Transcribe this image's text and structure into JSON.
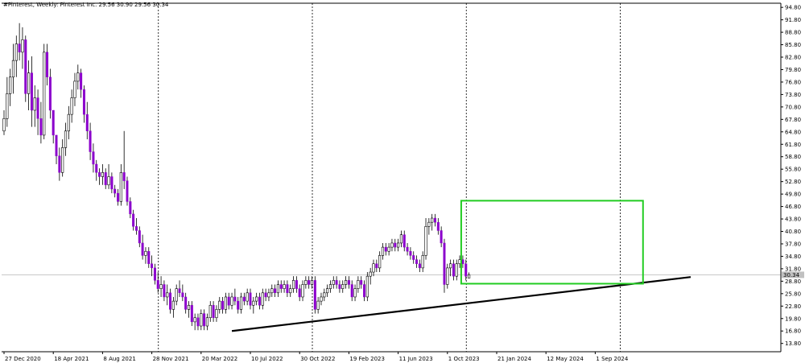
{
  "header": {
    "title": "#Pinterest, Weekly:  Pinterest Inc.  29.56 30.90 29.56 30.34"
  },
  "colors": {
    "background": "#ffffff",
    "bull_body": "#ffffff",
    "bull_edge": "#000000",
    "bear_body": "#8b00cc",
    "wick": "#000000",
    "grid": "#000000",
    "trendline": "#000000",
    "box": "#22cc22",
    "price_line": "#c0c0c0",
    "price_tag_bg": "#c0c0c0"
  },
  "chart_data": {
    "type": "candlestick",
    "title": "#Pinterest, Weekly:  Pinterest Inc.  29.56 30.90 29.56 30.34",
    "ylim": [
      11.8,
      95.8
    ],
    "y_ticks": [
      "94.80",
      "91.80",
      "88.80",
      "85.80",
      "82.80",
      "79.80",
      "76.80",
      "73.80",
      "70.80",
      "67.80",
      "64.80",
      "61.80",
      "58.80",
      "55.80",
      "52.80",
      "49.80",
      "46.80",
      "43.80",
      "40.80",
      "37.80",
      "34.80",
      "31.80",
      "28.80",
      "25.80",
      "22.80",
      "19.80",
      "16.80",
      "13.80"
    ],
    "x_ticks": [
      {
        "label": "27 Dec 2020",
        "bar": 0
      },
      {
        "label": "18 Apr 2021",
        "bar": 16
      },
      {
        "label": "8 Aug 2021",
        "bar": 32
      },
      {
        "label": "28 Nov 2021",
        "bar": 48
      },
      {
        "label": "20 Mar 2022",
        "bar": 64
      },
      {
        "label": "10 Jul 2022",
        "bar": 80
      },
      {
        "label": "30 Oct 2022",
        "bar": 96
      },
      {
        "label": "19 Feb 2023",
        "bar": 112
      },
      {
        "label": "11 Jun 2023",
        "bar": 128
      },
      {
        "label": "1 Oct 2023",
        "bar": 144
      },
      {
        "label": "21 Jan 2024",
        "bar": 160
      },
      {
        "label": "12 May 2024",
        "bar": 176
      },
      {
        "label": "1 Sep 2024",
        "bar": 192
      }
    ],
    "vgrid_bars": [
      50,
      100,
      150,
      200
    ],
    "last_price": "30.34",
    "candles": [
      [
        65,
        70,
        64,
        68
      ],
      [
        68,
        78,
        66,
        74
      ],
      [
        74,
        80,
        71,
        78
      ],
      [
        78,
        86,
        74,
        82
      ],
      [
        82,
        88,
        78,
        86
      ],
      [
        86,
        91,
        82,
        84
      ],
      [
        84,
        90,
        80,
        87
      ],
      [
        87,
        88,
        72,
        74
      ],
      [
        74,
        82,
        70,
        79
      ],
      [
        79,
        83,
        66,
        70
      ],
      [
        70,
        76,
        66,
        73
      ],
      [
        73,
        75,
        64,
        68
      ],
      [
        68,
        72,
        62,
        64
      ],
      [
        64,
        86,
        63,
        84
      ],
      [
        84,
        86,
        76,
        78
      ],
      [
        78,
        80,
        68,
        70
      ],
      [
        70,
        70,
        62,
        64
      ],
      [
        64,
        64,
        57,
        59
      ],
      [
        59,
        61,
        53,
        55
      ],
      [
        55,
        63,
        54,
        61
      ],
      [
        61,
        67,
        59,
        65
      ],
      [
        65,
        71,
        63,
        69
      ],
      [
        69,
        75,
        67,
        73
      ],
      [
        73,
        79,
        71,
        77
      ],
      [
        77,
        81,
        75,
        79
      ],
      [
        79,
        80,
        73,
        75
      ],
      [
        75,
        76,
        67,
        69
      ],
      [
        69,
        72,
        63,
        65
      ],
      [
        65,
        67,
        58,
        60
      ],
      [
        60,
        62,
        55,
        57
      ],
      [
        57,
        58,
        53,
        55
      ],
      [
        55,
        56,
        52,
        54
      ],
      [
        54,
        57,
        52,
        55
      ],
      [
        55,
        56,
        51,
        52
      ],
      [
        52,
        57,
        51,
        54
      ],
      [
        54,
        55,
        50,
        51
      ],
      [
        51,
        52,
        49,
        50
      ],
      [
        50,
        51,
        47,
        48
      ],
      [
        48,
        57,
        47,
        55
      ],
      [
        55,
        65,
        51,
        53
      ],
      [
        53,
        54,
        47,
        48
      ],
      [
        48,
        49,
        44,
        45
      ],
      [
        45,
        46,
        41,
        42
      ],
      [
        42,
        44,
        40,
        41
      ],
      [
        41,
        42,
        37,
        38
      ],
      [
        38,
        40,
        34,
        35
      ],
      [
        35,
        37,
        33,
        36
      ],
      [
        36,
        37,
        32,
        33
      ],
      [
        33,
        35,
        30,
        32
      ],
      [
        32,
        33,
        28,
        29
      ],
      [
        29,
        31,
        26,
        27
      ],
      [
        27,
        30,
        25,
        28
      ],
      [
        28,
        29,
        24,
        25
      ],
      [
        25,
        28,
        23,
        26
      ],
      [
        26,
        27,
        21,
        22
      ],
      [
        22,
        25,
        20,
        24
      ],
      [
        24,
        28,
        23,
        27
      ],
      [
        27,
        29,
        25,
        26
      ],
      [
        26,
        28,
        24,
        25
      ],
      [
        25,
        26,
        21,
        22
      ],
      [
        22,
        24,
        20,
        23
      ],
      [
        23,
        24,
        18,
        19
      ],
      [
        19,
        21,
        17,
        20
      ],
      [
        20,
        21,
        17,
        18
      ],
      [
        18,
        22,
        17,
        21
      ],
      [
        21,
        22,
        17,
        18
      ],
      [
        18,
        21,
        17,
        20
      ],
      [
        20,
        24,
        19,
        23
      ],
      [
        23,
        24,
        19,
        20
      ],
      [
        20,
        23,
        19,
        22
      ],
      [
        22,
        25,
        21,
        24
      ],
      [
        24,
        25,
        21,
        22
      ],
      [
        22,
        26,
        21,
        25
      ],
      [
        25,
        26,
        22,
        23
      ],
      [
        23,
        26,
        22,
        25
      ],
      [
        25,
        27,
        23,
        24
      ],
      [
        24,
        25,
        21,
        22
      ],
      [
        22,
        26,
        21,
        25
      ],
      [
        25,
        26,
        23,
        24
      ],
      [
        24,
        27,
        23,
        26
      ],
      [
        26,
        27,
        22,
        23
      ],
      [
        23,
        25,
        21,
        24
      ],
      [
        24,
        26,
        23,
        25
      ],
      [
        25,
        26,
        22,
        23
      ],
      [
        23,
        27,
        22,
        26
      ],
      [
        26,
        27,
        24,
        25
      ],
      [
        25,
        27,
        24,
        26
      ],
      [
        26,
        28,
        25,
        27
      ],
      [
        27,
        28,
        25,
        26
      ],
      [
        26,
        29,
        25,
        28
      ],
      [
        28,
        29,
        26,
        27
      ],
      [
        27,
        29,
        26,
        28
      ],
      [
        28,
        29,
        25,
        26
      ],
      [
        26,
        28,
        25,
        27
      ],
      [
        27,
        30,
        26,
        29
      ],
      [
        29,
        30,
        26,
        27
      ],
      [
        27,
        28,
        24,
        25
      ],
      [
        25,
        29,
        24,
        28
      ],
      [
        28,
        30,
        27,
        29
      ],
      [
        29,
        30,
        27,
        28
      ],
      [
        28,
        30,
        27,
        29
      ],
      [
        29,
        30,
        21,
        22
      ],
      [
        22,
        25,
        21,
        24
      ],
      [
        24,
        26,
        23,
        25
      ],
      [
        25,
        27,
        24,
        26
      ],
      [
        26,
        28,
        25,
        27
      ],
      [
        27,
        29,
        26,
        28
      ],
      [
        28,
        30,
        27,
        29
      ],
      [
        29,
        30,
        27,
        28
      ],
      [
        28,
        29,
        26,
        27
      ],
      [
        27,
        29,
        26,
        28
      ],
      [
        28,
        30,
        27,
        29
      ],
      [
        29,
        30,
        27,
        28
      ],
      [
        28,
        29,
        24,
        25
      ],
      [
        25,
        28,
        24,
        27
      ],
      [
        27,
        30,
        26,
        29
      ],
      [
        29,
        30,
        27,
        28
      ],
      [
        28,
        29,
        24,
        25
      ],
      [
        25,
        31,
        24,
        30
      ],
      [
        30,
        32,
        28,
        31
      ],
      [
        31,
        34,
        30,
        33
      ],
      [
        33,
        34,
        31,
        32
      ],
      [
        32,
        36,
        31,
        35
      ],
      [
        35,
        38,
        34,
        37
      ],
      [
        37,
        38,
        35,
        36
      ],
      [
        36,
        38,
        35,
        37
      ],
      [
        37,
        39,
        36,
        38
      ],
      [
        38,
        39,
        36,
        37
      ],
      [
        37,
        39,
        36,
        38
      ],
      [
        38,
        41,
        37,
        40
      ],
      [
        40,
        41,
        36,
        37
      ],
      [
        37,
        38,
        35,
        36
      ],
      [
        36,
        37,
        34,
        35
      ],
      [
        35,
        36,
        33,
        34
      ],
      [
        34,
        35,
        32,
        33
      ],
      [
        33,
        34,
        31,
        32
      ],
      [
        32,
        36,
        31,
        35
      ],
      [
        35,
        44,
        34,
        42
      ],
      [
        42,
        44,
        40,
        43
      ],
      [
        43,
        45,
        41,
        44
      ],
      [
        44,
        45,
        42,
        43
      ],
      [
        43,
        44,
        40,
        41
      ],
      [
        41,
        42,
        37,
        38
      ],
      [
        38,
        39,
        26,
        28
      ],
      [
        28,
        33,
        27,
        32
      ],
      [
        32,
        34,
        30,
        33
      ],
      [
        33,
        34,
        29,
        30
      ],
      [
        30,
        34,
        29,
        33
      ],
      [
        33,
        35,
        32,
        34
      ],
      [
        34,
        35,
        32,
        33
      ],
      [
        33,
        34,
        29,
        30
      ],
      [
        29.56,
        30.9,
        29.56,
        30.34
      ]
    ]
  }
}
